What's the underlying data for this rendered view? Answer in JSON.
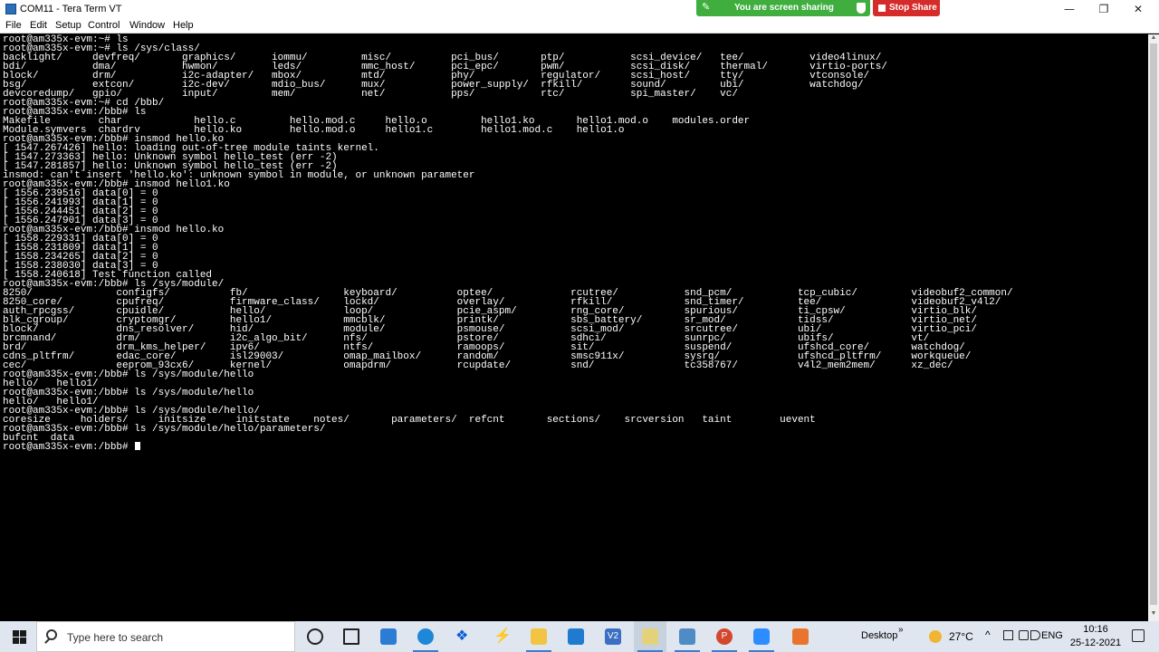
{
  "window": {
    "title": "COM11 - Tera Term VT",
    "minimize": "—",
    "maximize": "❐",
    "close": "✕"
  },
  "screenshare": {
    "status_text": "You are screen sharing",
    "stop_label": "Stop Share",
    "bar_color": "#3fae3f",
    "stop_color": "#d52b2b"
  },
  "menu": {
    "items": [
      "File",
      "Edit",
      "Setup",
      "Control",
      "Window",
      "Help"
    ]
  },
  "terminal": {
    "lines": [
      "root@am335x-evm:~# ls",
      "root@am335x-evm:~# ls /sys/class/",
      "backlight/     devfreq/       graphics/      iommu/         misc/          pci_bus/       ptp/           scsi_device/   tee/           video4linux/",
      "bdi/           dma/           hwmon/         leds/          mmc_host/      pci_epc/       pwm/           scsi_disk/     thermal/       virtio-ports/",
      "block/         drm/           i2c-adapter/   mbox/          mtd/           phy/           regulator/     scsi_host/     tty/           vtconsole/",
      "bsg/           extcon/        i2c-dev/       mdio_bus/      mux/           power_supply/  rfkill/        sound/         ubi/           watchdog/",
      "devcoredump/   gpio/          input/         mem/           net/           pps/           rtc/           spi_master/    vc/",
      "root@am335x-evm:~# cd /bbb/",
      "root@am335x-evm:/bbb# ls",
      "Makefile        char            hello.c         hello.mod.c     hello.o         hello1.ko       hello1.mod.o    modules.order",
      "Module.symvers  chardrv         hello.ko        hello.mod.o     hello1.c        hello1.mod.c    hello1.o",
      "root@am335x-evm:/bbb# insmod hello.ko",
      "[ 1547.267426] hello: loading out-of-tree module taints kernel.",
      "[ 1547.273363] hello: Unknown symbol hello_test (err -2)",
      "[ 1547.281857] hello: Unknown symbol hello_test (err -2)",
      "insmod: can't insert 'hello.ko': unknown symbol in module, or unknown parameter",
      "root@am335x-evm:/bbb# insmod hello1.ko",
      "[ 1556.239516] data[0] = 0",
      "[ 1556.241993] data[1] = 0",
      "[ 1556.244451] data[2] = 0",
      "[ 1556.247901] data[3] = 0",
      "root@am335x-evm:/bbb# insmod hello.ko",
      "[ 1558.229331] data[0] = 0",
      "[ 1558.231809] data[1] = 0",
      "[ 1558.234265] data[2] = 0",
      "[ 1558.238030] data[3] = 0",
      "[ 1558.240618] Test function called",
      "root@am335x-evm:/bbb# ls /sys/module/",
      "8250/              configfs/          fb/                keyboard/          optee/             rcutree/           snd_pcm/           tcp_cubic/         videobuf2_common/",
      "8250_core/         cpufreq/           firmware_class/    lockd/             overlay/           rfkill/            snd_timer/         tee/               videobuf2_v4l2/",
      "auth_rpcgss/       cpuidle/           hello/             loop/              pcie_aspm/         rng_core/          spurious/          ti_cpsw/           virtio_blk/",
      "blk_cgroup/        cryptomgr/         hello1/            mmcblk/            printk/            sbs_battery/       sr_mod/            tidss/             virtio_net/",
      "block/             dns_resolver/      hid/               module/            psmouse/           scsi_mod/          srcutree/          ubi/               virtio_pci/",
      "brcmnand/          drm/               i2c_algo_bit/      nfs/               pstore/            sdhci/             sunrpc/            ubifs/             vt/",
      "brd/               drm_kms_helper/    ipv6/              ntfs/              ramoops/           sit/               suspend/           ufshcd_core/       watchdog/",
      "cdns_pltfrm/       edac_core/         isl29003/          omap_mailbox/      random/            smsc911x/          sysrq/             ufshcd_pltfrm/     workqueue/",
      "cec/               eeprom_93cx6/      kernel/            omapdrm/           rcupdate/          snd/               tc358767/          v4l2_mem2mem/      xz_dec/",
      "root@am335x-evm:/bbb# ls /sys/module/hello",
      "hello/   hello1/",
      "root@am335x-evm:/bbb# ls /sys/module/hello",
      "hello/   hello1/",
      "root@am335x-evm:/bbb# ls /sys/module/hello/",
      "coresize     holders/     initsize     initstate    notes/       parameters/  refcnt       sections/    srcversion   taint        uevent",
      "root@am335x-evm:/bbb# ls /sys/module/hello/parameters/",
      "bufcnt  data",
      "root@am335x-evm:/bbb# "
    ]
  },
  "taskbar": {
    "search_placeholder": "Type here to search",
    "apps": [
      "cortana",
      "task-view",
      "microsoft-store",
      "edge",
      "dropbox",
      "visual-studio",
      "file-explorer",
      "mail",
      "v2",
      "tera-term",
      "network-app",
      "powerpoint",
      "zoom",
      "misc-app"
    ],
    "v2_label": "V2",
    "ppt_label": "P",
    "desktop_label": "Desktop",
    "chevron": "»",
    "tray_up": "^",
    "temperature": "27°C",
    "language": "ENG",
    "time": "10:16",
    "date": "25-12-2021"
  }
}
